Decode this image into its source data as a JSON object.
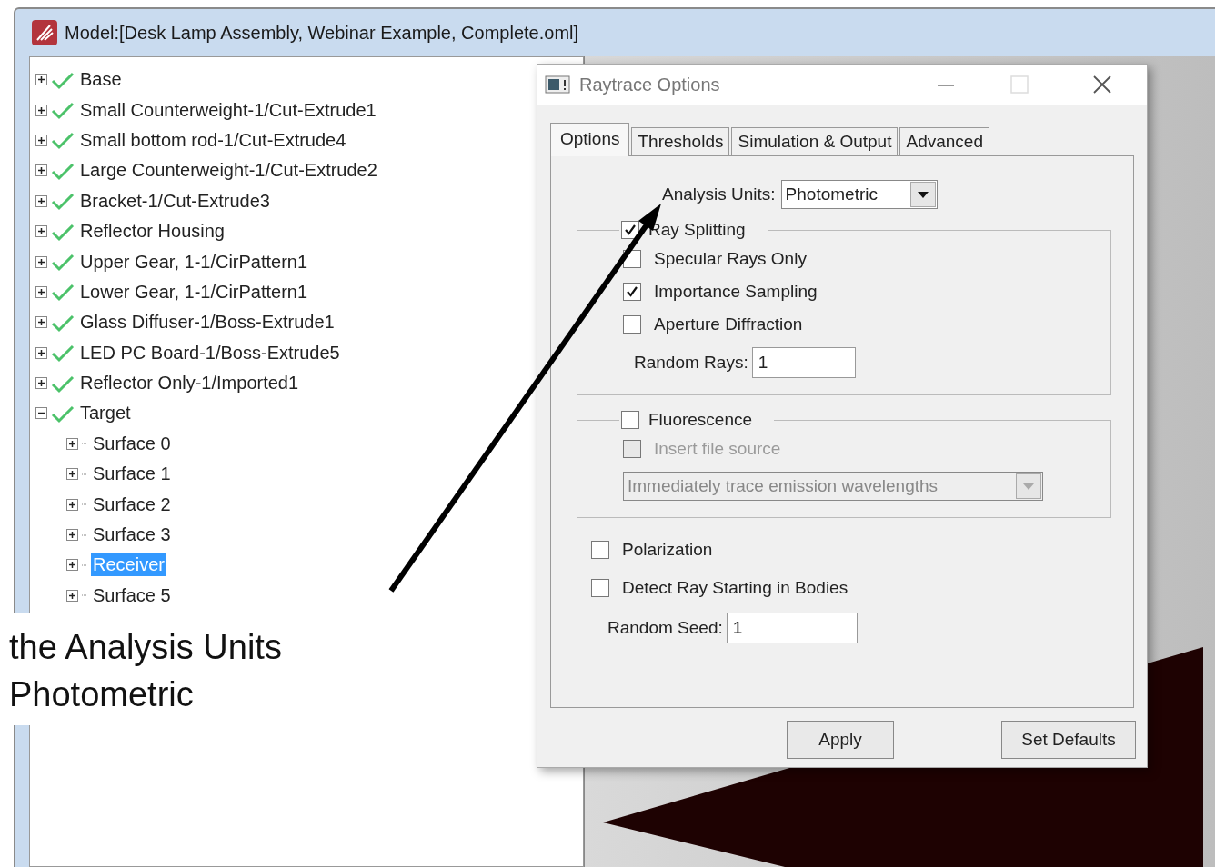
{
  "window": {
    "title": "Model:[Desk Lamp Assembly, Webinar Example, Complete.oml]"
  },
  "tree": {
    "items": [
      {
        "label": "Base",
        "kind": "object",
        "expanded": false,
        "selected": false
      },
      {
        "label": "Small Counterweight-1/Cut-Extrude1",
        "kind": "object",
        "expanded": false,
        "selected": false
      },
      {
        "label": "Small bottom rod-1/Cut-Extrude4",
        "kind": "object",
        "expanded": false,
        "selected": false
      },
      {
        "label": "Large Counterweight-1/Cut-Extrude2",
        "kind": "object",
        "expanded": false,
        "selected": false
      },
      {
        "label": "Bracket-1/Cut-Extrude3",
        "kind": "object",
        "expanded": false,
        "selected": false
      },
      {
        "label": "Reflector Housing",
        "kind": "object",
        "expanded": false,
        "selected": false
      },
      {
        "label": "Upper Gear, 1-1/CirPattern1",
        "kind": "object",
        "expanded": false,
        "selected": false
      },
      {
        "label": "Lower Gear, 1-1/CirPattern1",
        "kind": "object",
        "expanded": false,
        "selected": false
      },
      {
        "label": "Glass Diffuser-1/Boss-Extrude1",
        "kind": "object",
        "expanded": false,
        "selected": false
      },
      {
        "label": "LED PC Board-1/Boss-Extrude5",
        "kind": "object",
        "expanded": false,
        "selected": false
      },
      {
        "label": "Reflector Only-1/Imported1",
        "kind": "object",
        "expanded": false,
        "selected": false
      },
      {
        "label": "Target",
        "kind": "object",
        "expanded": true,
        "selected": false,
        "children": [
          {
            "label": "Surface 0",
            "kind": "surface",
            "expanded": false,
            "selected": false
          },
          {
            "label": "Surface 1",
            "kind": "surface",
            "expanded": false,
            "selected": false
          },
          {
            "label": "Surface 2",
            "kind": "surface",
            "expanded": false,
            "selected": false
          },
          {
            "label": "Surface 3",
            "kind": "surface",
            "expanded": false,
            "selected": false
          },
          {
            "label": "Receiver",
            "kind": "surface",
            "expanded": false,
            "selected": true
          },
          {
            "label": "Surface 5",
            "kind": "surface",
            "expanded": false,
            "selected": false
          }
        ]
      }
    ]
  },
  "dialog": {
    "title": "Raytrace Options",
    "tabs": [
      {
        "label": "Options",
        "selected": true
      },
      {
        "label": "Thresholds",
        "selected": false
      },
      {
        "label": "Simulation & Output",
        "selected": false
      },
      {
        "label": "Advanced",
        "selected": false
      }
    ],
    "analysis_units": {
      "label": "Analysis Units:",
      "value": "Photometric"
    },
    "ray_splitting": {
      "label": "Ray Splitting",
      "checked": true,
      "options": [
        {
          "label": "Specular Rays Only",
          "checked": false
        },
        {
          "label": "Importance Sampling",
          "checked": true
        },
        {
          "label": "Aperture Diffraction",
          "checked": false
        }
      ],
      "random_rays": {
        "label": "Random Rays:",
        "value": "1"
      }
    },
    "fluorescence": {
      "label": "Fluorescence",
      "checked": false,
      "insert_file_source": {
        "label": "Insert file source",
        "checked": false,
        "disabled": true
      },
      "emission_mode": {
        "value": "Immediately trace emission wavelengths",
        "disabled": true
      }
    },
    "polarization": {
      "label": "Polarization",
      "checked": false
    },
    "detect_ray_starting": {
      "label": "Detect Ray Starting in Bodies",
      "checked": false
    },
    "random_seed": {
      "label": "Random Seed:",
      "value": "1"
    },
    "buttons": [
      "Apply",
      "Set Defaults"
    ]
  },
  "annotation": {
    "lines": [
      "the Analysis Units",
      "Photometric"
    ]
  }
}
